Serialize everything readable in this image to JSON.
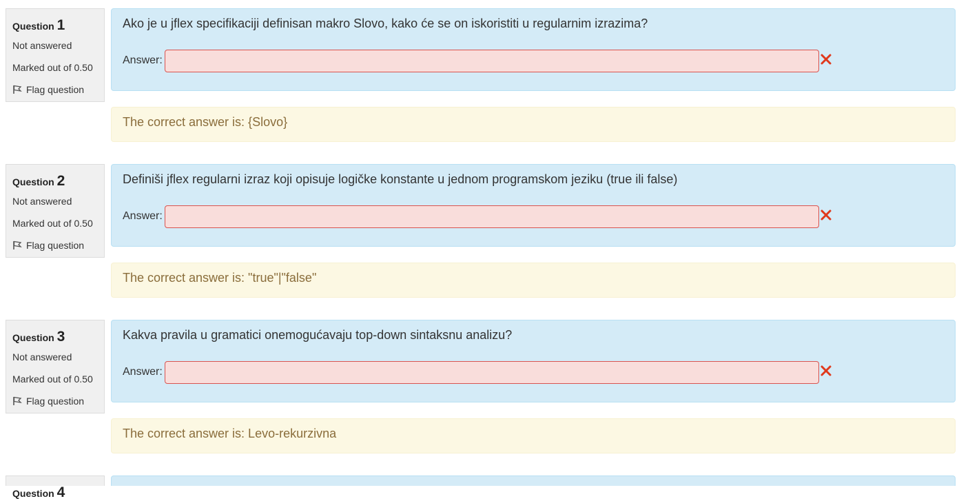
{
  "questions": [
    {
      "label": "Question",
      "number": "1",
      "state": "Not answered",
      "grade": "Marked out of 0.50",
      "flag_label": "Flag question",
      "text": "Ako je u jflex specifikaciji definisan makro Slovo, kako će se on iskoristiti u regularnim izrazima?",
      "answer_label": "Answer:",
      "answer_value": "",
      "correct_answer": "The correct answer is: {Slovo}"
    },
    {
      "label": "Question",
      "number": "2",
      "state": "Not answered",
      "grade": "Marked out of 0.50",
      "flag_label": "Flag question",
      "text": "Definiši jflex regularni izraz koji opisuje logičke konstante u jednom programskom jeziku (true ili false)",
      "answer_label": "Answer:",
      "answer_value": "",
      "correct_answer": "The correct answer is: \"true\"|\"false\""
    },
    {
      "label": "Question",
      "number": "3",
      "state": "Not answered",
      "grade": "Marked out of 0.50",
      "flag_label": "Flag question",
      "text": "Kakva pravila u gramatici onemogućavaju top-down sintaksnu analizu?",
      "answer_label": "Answer:",
      "answer_value": "",
      "correct_answer": "The correct answer is: Levo-rekurzivna"
    },
    {
      "label": "Question",
      "number": "4"
    }
  ],
  "colors": {
    "formulation_bg": "#d4ebf7",
    "incorrect_input_bg": "#f9dddb",
    "incorrect_mark": "#e0391c",
    "feedback_bg": "#fcf8e3",
    "feedback_text": "#8a6d3b"
  },
  "icons": {
    "flag": "flag-icon",
    "incorrect": "incorrect-x-icon"
  }
}
